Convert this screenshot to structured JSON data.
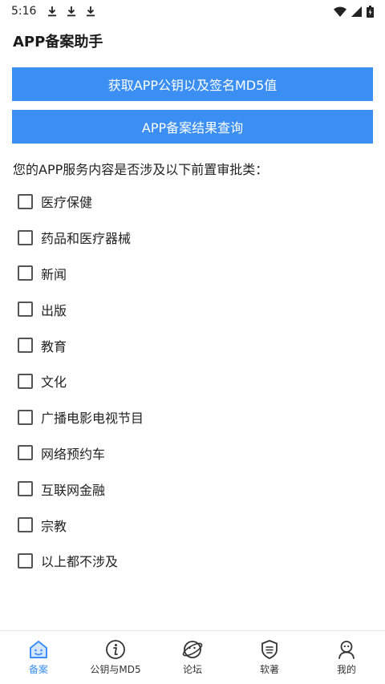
{
  "status_bar": {
    "time": "5:16"
  },
  "header": {
    "title": "APP备案助手"
  },
  "actions": {
    "md5_button": "获取APP公钥以及签名MD5值",
    "query_button": "APP备案结果查询"
  },
  "form": {
    "question": "您的APP服务内容是否涉及以下前置审批类：",
    "options": [
      {
        "label": "医疗保健",
        "checked": false
      },
      {
        "label": "药品和医疗器械",
        "checked": false
      },
      {
        "label": "新闻",
        "checked": false
      },
      {
        "label": "出版",
        "checked": false
      },
      {
        "label": "教育",
        "checked": false
      },
      {
        "label": "文化",
        "checked": false
      },
      {
        "label": "广播电影电视节目",
        "checked": false
      },
      {
        "label": "网络预约车",
        "checked": false
      },
      {
        "label": "互联网金融",
        "checked": false
      },
      {
        "label": "宗教",
        "checked": false
      },
      {
        "label": "以上都不涉及",
        "checked": false
      }
    ]
  },
  "bottom_nav": {
    "items": [
      {
        "label": "备案",
        "icon": "home-icon",
        "active": true
      },
      {
        "label": "公钥与MD5",
        "icon": "info-icon",
        "active": false
      },
      {
        "label": "论坛",
        "icon": "planet-icon",
        "active": false
      },
      {
        "label": "软著",
        "icon": "certificate-shield-icon",
        "active": false
      },
      {
        "label": "我的",
        "icon": "user-icon",
        "active": false
      }
    ],
    "active_color": "#3b8ff3",
    "inactive_color": "#333333"
  },
  "colors": {
    "accent": "#3b8ff3"
  }
}
